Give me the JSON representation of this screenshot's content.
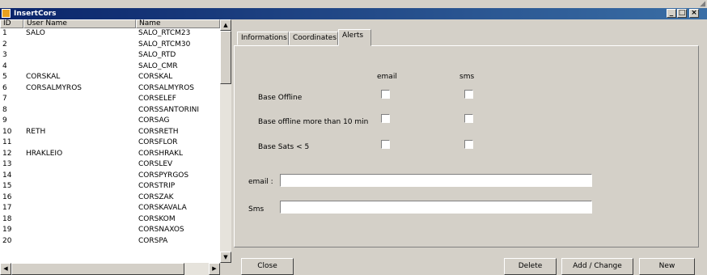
{
  "window": {
    "title": "InsertCors",
    "controls": [
      "_",
      "□",
      "×"
    ]
  },
  "list": {
    "headers": [
      "ID",
      "User Name",
      "Name"
    ],
    "rows": [
      {
        "id": "1",
        "user": "SALO",
        "name": "SALO_RTCM23"
      },
      {
        "id": "2",
        "user": "",
        "name": "SALO_RTCM30"
      },
      {
        "id": "3",
        "user": "",
        "name": "SALO_RTD"
      },
      {
        "id": "4",
        "user": "",
        "name": "SALO_CMR"
      },
      {
        "id": "5",
        "user": "CORSKAL",
        "name": "CORSKAL"
      },
      {
        "id": "6",
        "user": "CORSALMYROS",
        "name": "CORSALMYROS"
      },
      {
        "id": "7",
        "user": "",
        "name": "CORSELEF"
      },
      {
        "id": "8",
        "user": "",
        "name": "CORSSANTORINI"
      },
      {
        "id": "9",
        "user": "",
        "name": "CORSAG"
      },
      {
        "id": "10",
        "user": "RETH",
        "name": "CORSRETH"
      },
      {
        "id": "11",
        "user": "",
        "name": "CORSFLOR"
      },
      {
        "id": "12",
        "user": "HRAKLEIO",
        "name": "CORSHRAKL"
      },
      {
        "id": "13",
        "user": "",
        "name": "CORSLEV"
      },
      {
        "id": "14",
        "user": "",
        "name": "CORSPYRGOS"
      },
      {
        "id": "15",
        "user": "",
        "name": "CORSTRIP"
      },
      {
        "id": "16",
        "user": "",
        "name": "CORSZAK"
      },
      {
        "id": "17",
        "user": "",
        "name": "CORSKAVALA"
      },
      {
        "id": "18",
        "user": "",
        "name": "CORSKOM"
      },
      {
        "id": "19",
        "user": "",
        "name": "CORSNAXOS"
      },
      {
        "id": "20",
        "user": "",
        "name": "CORSPA"
      }
    ]
  },
  "tabs": [
    "Informations",
    "Coordinates",
    "Alerts"
  ],
  "alerts": {
    "col_email": "email",
    "col_sms": "sms",
    "base_offline": "Base Offline",
    "base_offline_10": "Base offline more than 10 min",
    "base_sats": "Base Sats < 5",
    "email_label": "email :",
    "sms_label": "Sms",
    "email_value": "",
    "sms_value": ""
  },
  "buttons": {
    "close": "Close",
    "delete": "Delete",
    "add_change": "Add / Change",
    "new": "New"
  }
}
